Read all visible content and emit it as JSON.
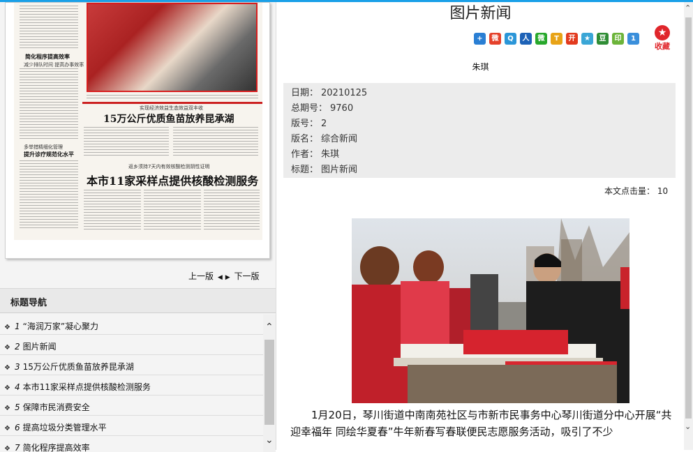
{
  "newspaper_page": {
    "headline_small_1": "简化程序提高效率",
    "subhead_small_1": "减少排队时间 提高办事效率",
    "headline_small_2": "多举措精细化管理",
    "subhead_small_2": "提升诊疗规范化水平",
    "kicker_1": "实现经济效益生态效益双丰收",
    "headline_1": "15万公斤优质鱼苗放养昆承湖",
    "kicker_2": "返乡须持7天内有效核酸检测阴性证明",
    "headline_2": "本市11家采样点提供核酸检测服务"
  },
  "pager": {
    "prev": "上一版",
    "next": "下一版"
  },
  "nav": {
    "title": "标题导航",
    "items": [
      {
        "num": "1",
        "label": "“海润万家”凝心聚力"
      },
      {
        "num": "2",
        "label": "图片新闻"
      },
      {
        "num": "3",
        "label": "15万公斤优质鱼苗放养昆承湖"
      },
      {
        "num": "4",
        "label": "本市11家采样点提供核酸检测服务"
      },
      {
        "num": "5",
        "label": "保障市民消费安全"
      },
      {
        "num": "6",
        "label": "提高垃圾分类管理水平"
      },
      {
        "num": "7",
        "label": "简化程序提高效率"
      }
    ]
  },
  "article": {
    "page_title": "图片新闻",
    "author": "朱琪",
    "meta": [
      {
        "key": "日期：",
        "value": "20210125"
      },
      {
        "key": "总期号：",
        "value": "9760"
      },
      {
        "key": "版号：",
        "value": "2"
      },
      {
        "key": "版名：",
        "value": "综合新闻"
      },
      {
        "key": "作者：",
        "value": "朱琪"
      },
      {
        "key": "标题：",
        "value": "图片新闻"
      }
    ],
    "clicks_label": "本文点击量：",
    "clicks_value": "10",
    "body": "1月20日，琴川街道中南南苑社区与市新市民事务中心琴川街道分中心开展“共迎幸福年 同绘华夏春”牛年新春写春联便民志愿服务活动，吸引了不少"
  },
  "share": {
    "icons": [
      {
        "name": "plus-share-icon",
        "glyph": "+",
        "color": "#2a7fd4"
      },
      {
        "name": "weibo-share-icon",
        "glyph": "微",
        "color": "#e5412b"
      },
      {
        "name": "qzone-share-icon",
        "glyph": "Q",
        "color": "#2b96d8"
      },
      {
        "name": "renren-share-icon",
        "glyph": "人",
        "color": "#1d62b7"
      },
      {
        "name": "wechat-share-icon",
        "glyph": "微",
        "color": "#27a82c"
      },
      {
        "name": "tieba-share-icon",
        "glyph": "T",
        "color": "#e8a317"
      },
      {
        "name": "kaixin-share-icon",
        "glyph": "开",
        "color": "#e23a1e"
      },
      {
        "name": "star-share-icon",
        "glyph": "★",
        "color": "#3aa6d6"
      },
      {
        "name": "douban-share-icon",
        "glyph": "豆",
        "color": "#2f8d35"
      },
      {
        "name": "print-share-icon",
        "glyph": "印",
        "color": "#6cb43a"
      },
      {
        "name": "one-share-icon",
        "glyph": "1",
        "color": "#3a8fdb"
      }
    ],
    "favorite_label": "收藏"
  }
}
